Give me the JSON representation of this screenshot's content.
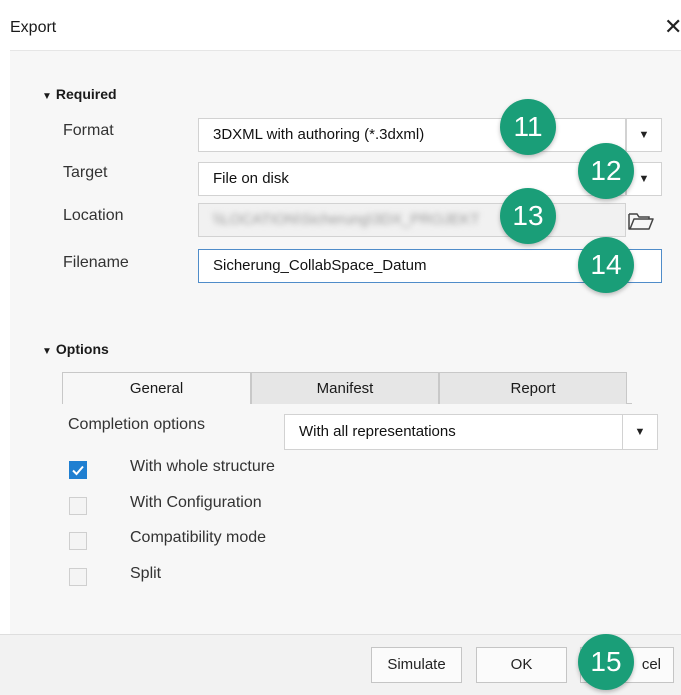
{
  "window": {
    "title": "Export",
    "close_glyph": "✕"
  },
  "required": {
    "heading": "Required",
    "format": {
      "label": "Format",
      "value": "3DXML with authoring (*.3dxml)"
    },
    "target": {
      "label": "Target",
      "value": "File on disk"
    },
    "location": {
      "label": "Location",
      "value": "\\\\LOCATION\\Sicherung\\3DX_PROJEKT"
    },
    "filename": {
      "label": "Filename",
      "value": "Sicherung_CollabSpace_Datum"
    }
  },
  "options": {
    "heading": "Options",
    "tabs": [
      {
        "label": "General",
        "active": true
      },
      {
        "label": "Manifest",
        "active": false
      },
      {
        "label": "Report",
        "active": false
      }
    ],
    "completion": {
      "label": "Completion options",
      "value": "With all representations"
    },
    "checks": [
      {
        "label": "With whole structure",
        "checked": true
      },
      {
        "label": "With Configuration",
        "checked": false
      },
      {
        "label": "Compatibility mode",
        "checked": false
      },
      {
        "label": "Split",
        "checked": false
      }
    ]
  },
  "footer": {
    "simulate": "Simulate",
    "ok": "OK",
    "cancel": "cel"
  },
  "badges": [
    "11",
    "12",
    "13",
    "14",
    "15"
  ],
  "icons": {
    "dropdown": "chevron-down-icon",
    "folder": "folder-icon",
    "check": "checkmark-icon"
  },
  "colors": {
    "badge": "#1a9e78",
    "checkbox_checked": "#1f7fd1",
    "focus_border": "#4f8cc9"
  }
}
